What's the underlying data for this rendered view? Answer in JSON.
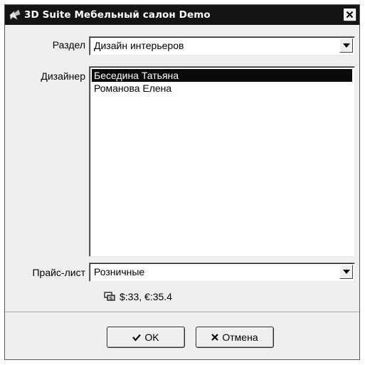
{
  "window": {
    "title": "3D Suite Мебельный салон Demo",
    "app_icon": "app-logo-icon",
    "close_icon": "close-icon"
  },
  "section": {
    "label": "Раздел",
    "value": "Дизайн интерьеров"
  },
  "designer": {
    "label": "Дизайнер",
    "items": [
      "Беседина Татьяна",
      "Романова Елена"
    ],
    "selected_index": 0
  },
  "pricelist": {
    "label": "Прайс-лист",
    "value": "Розничные"
  },
  "currency": {
    "icon": "currency-rates-icon",
    "text": "$:33, €:35.4"
  },
  "buttons": {
    "ok_label": "OK",
    "ok_icon": "checkmark-icon",
    "cancel_label": "Отмена",
    "cancel_icon": "cross-icon"
  },
  "colors": {
    "titlebar": "#141414",
    "selection": "#0a0a0a",
    "window_bg": "#efefef"
  }
}
